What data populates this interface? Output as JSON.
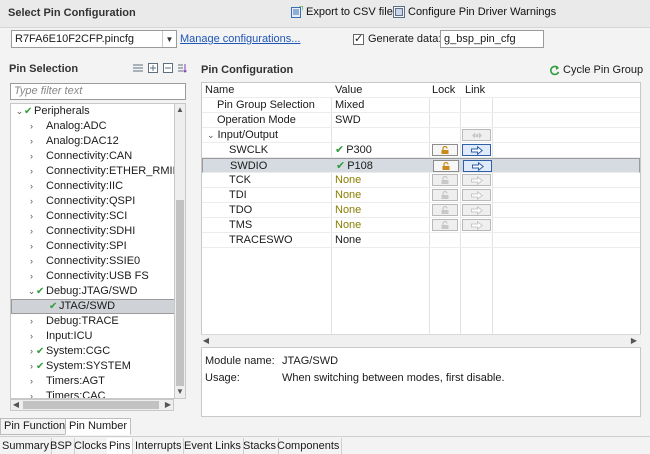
{
  "header": {
    "title": "Select Pin Configuration",
    "export_label": "Export to CSV file",
    "configure_label": "Configure Pin Driver Warnings"
  },
  "config": {
    "selected_file": "R7FA6E10F2CFP.pincfg",
    "manage_link": "Manage configurations...",
    "generate_label": "Generate data:",
    "generate_checked": true,
    "generate_value": "g_bsp_pin_cfg"
  },
  "pin_selection": {
    "title": "Pin Selection",
    "filter_placeholder": "Type filter text",
    "tree": [
      {
        "label": "Peripherals",
        "twisty": "v",
        "tick": true,
        "indent": 0
      },
      {
        "label": "Analog:ADC",
        "twisty": ">",
        "tick": false,
        "indent": 1
      },
      {
        "label": "Analog:DAC12",
        "twisty": ">",
        "tick": false,
        "indent": 1
      },
      {
        "label": "Connectivity:CAN",
        "twisty": ">",
        "tick": false,
        "indent": 1
      },
      {
        "label": "Connectivity:ETHER_RMII",
        "twisty": ">",
        "tick": false,
        "indent": 1
      },
      {
        "label": "Connectivity:IIC",
        "twisty": ">",
        "tick": false,
        "indent": 1
      },
      {
        "label": "Connectivity:QSPI",
        "twisty": ">",
        "tick": false,
        "indent": 1
      },
      {
        "label": "Connectivity:SCI",
        "twisty": ">",
        "tick": false,
        "indent": 1
      },
      {
        "label": "Connectivity:SDHI",
        "twisty": ">",
        "tick": false,
        "indent": 1
      },
      {
        "label": "Connectivity:SPI",
        "twisty": ">",
        "tick": false,
        "indent": 1
      },
      {
        "label": "Connectivity:SSIE0",
        "twisty": ">",
        "tick": false,
        "indent": 1
      },
      {
        "label": "Connectivity:USB FS",
        "twisty": ">",
        "tick": false,
        "indent": 1
      },
      {
        "label": "Debug:JTAG/SWD",
        "twisty": "v",
        "tick": true,
        "indent": 1
      },
      {
        "label": "JTAG/SWD",
        "twisty": "",
        "tick": true,
        "indent": 2,
        "selected": true
      },
      {
        "label": "Debug:TRACE",
        "twisty": ">",
        "tick": false,
        "indent": 1
      },
      {
        "label": "Input:ICU",
        "twisty": ">",
        "tick": false,
        "indent": 1
      },
      {
        "label": "System:CGC",
        "twisty": ">",
        "tick": true,
        "indent": 1
      },
      {
        "label": "System:SYSTEM",
        "twisty": ">",
        "tick": true,
        "indent": 1
      },
      {
        "label": "Timers:AGT",
        "twisty": ">",
        "tick": false,
        "indent": 1
      },
      {
        "label": "Timers:CAC",
        "twisty": ">",
        "tick": false,
        "indent": 1
      }
    ]
  },
  "pin_configuration": {
    "title": "Pin Configuration",
    "cycle_label": "Cycle Pin Group",
    "columns": [
      "Name",
      "Value",
      "Lock",
      "Link"
    ],
    "rows": [
      {
        "name": "Pin Group Selection",
        "value": "Mixed",
        "indent": 1,
        "twisty": "",
        "tick": false,
        "lock": "",
        "link": ""
      },
      {
        "name": "Operation Mode",
        "value": "SWD",
        "indent": 1,
        "twisty": "",
        "tick": false,
        "lock": "",
        "link": ""
      },
      {
        "name": "Input/Output",
        "value": "",
        "indent": 0,
        "twisty": "v",
        "tick": false,
        "lock": "",
        "link": "group"
      },
      {
        "name": "SWCLK",
        "value": "P300",
        "indent": 2,
        "twisty": "",
        "tick": true,
        "lock": "active",
        "link": "active"
      },
      {
        "name": "SWDIO",
        "value": "P108",
        "indent": 2,
        "twisty": "",
        "tick": true,
        "lock": "active",
        "link": "active",
        "selected": true
      },
      {
        "name": "TCK",
        "value": "None",
        "indent": 2,
        "twisty": "",
        "tick": false,
        "lock": "inactive",
        "link": "inactive"
      },
      {
        "name": "TDI",
        "value": "None",
        "indent": 2,
        "twisty": "",
        "tick": false,
        "lock": "inactive",
        "link": "inactive"
      },
      {
        "name": "TDO",
        "value": "None",
        "indent": 2,
        "twisty": "",
        "tick": false,
        "lock": "inactive",
        "link": "inactive"
      },
      {
        "name": "TMS",
        "value": "None",
        "indent": 2,
        "twisty": "",
        "tick": false,
        "lock": "inactive",
        "link": "inactive"
      },
      {
        "name": "TRACESWO",
        "value": "None",
        "indent": 2,
        "twisty": "",
        "tick": false,
        "lock": "",
        "link": "",
        "plain": true
      }
    ],
    "module_name_label": "Module name:",
    "module_name": "JTAG/SWD",
    "usage_label": "Usage:",
    "usage": "When switching between modes, first disable."
  },
  "view_tabs": [
    "Pin Function",
    "Pin Number"
  ],
  "view_tab_active": 1,
  "editor_tabs": [
    "Summary",
    "BSP",
    "Clocks",
    "Pins",
    "Interrupts",
    "Event Links",
    "Stacks",
    "Components"
  ],
  "editor_tab_active": 3,
  "colors": {
    "tick": "#2f9d3b",
    "none_value": "#8a7e00",
    "link": "#1f56b6"
  }
}
